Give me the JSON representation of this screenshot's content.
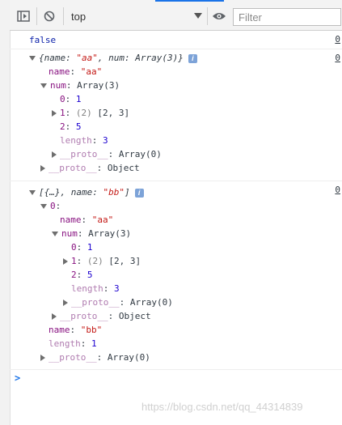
{
  "toolbar": {
    "context": "top",
    "filter_placeholder": "Filter",
    "icons": [
      "sidebar-toggle-icon",
      "clear-console-icon",
      "eye-icon"
    ]
  },
  "messages": {
    "m1": {
      "value": "false",
      "src": "0"
    },
    "m2": {
      "src": "0",
      "preview_open": "{name: ",
      "preview_name": "\"aa\"",
      "preview_mid": ", num: ",
      "preview_arr": "Array(3)",
      "preview_close": "}",
      "info": "i",
      "name_key": "name",
      "name_val": "\"aa\"",
      "num_key": "num",
      "num_val": "Array(3)",
      "k0": "0",
      "v0": "1",
      "k1": "1",
      "v1_count": "(2)",
      "v1_arr": "[2, 3]",
      "k2": "2",
      "v2": "5",
      "len_key": "length",
      "len_val": "3",
      "proto_key": "__proto__",
      "proto_arr": "Array(0)",
      "proto_obj": "Object"
    },
    "m3": {
      "src": "0",
      "preview_open": "[{…}, name: ",
      "preview_name": "\"bb\"",
      "preview_close": "]",
      "info": "i",
      "idx_key": "0",
      "name_key": "name",
      "name_val": "\"aa\"",
      "num_key": "num",
      "num_val": "Array(3)",
      "k0": "0",
      "v0": "1",
      "k1": "1",
      "v1_count": "(2)",
      "v1_arr": "[2, 3]",
      "k2": "2",
      "v2": "5",
      "len_key": "length",
      "len_val": "3",
      "proto_key": "__proto__",
      "proto_arr": "Array(0)",
      "proto_obj": "Object",
      "outer_name_key": "name",
      "outer_name_val": "\"bb\"",
      "outer_len_key": "length",
      "outer_len_val": "1",
      "outer_proto_key": "__proto__",
      "outer_proto_val": "Array(0)"
    }
  },
  "prompt": ">",
  "watermark": "https://blog.csdn.net/qq_44314839",
  "colors": {
    "key": "#881280",
    "string": "#c41a16",
    "number": "#1c00cf",
    "accent": "#1a73e8"
  }
}
